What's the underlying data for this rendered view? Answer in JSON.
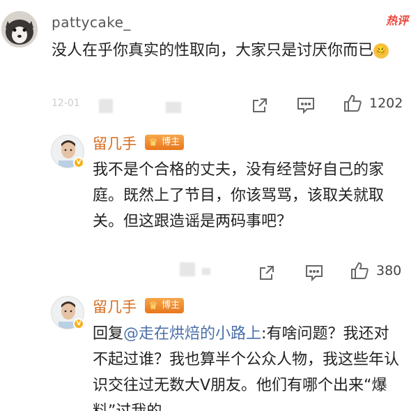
{
  "comments": [
    {
      "username": "pattycake_",
      "hot_tag": "热评",
      "text": "没人在乎你真实的性取向，大家只是讨厌你而已",
      "emoji": "🥴",
      "timestamp": "12-01",
      "likes": "1202"
    },
    {
      "username": "留几手",
      "badge": "博主",
      "text": "我不是个合格的丈夫，没有经营好自己的家庭。既然上了节目，你该骂骂，该取关就取关。但这跟造谣是两码事吧？",
      "likes": "380"
    },
    {
      "username": "留几手",
      "badge": "博主",
      "reply_prefix": "回复",
      "mention": "@走在烘焙的小路上",
      "text": ":有啥问题？我还对不起过谁？我也算半个公众人物，我这些年认识交往过无数大V朋友。他们有哪个出来“爆料”过我的"
    }
  ],
  "icons": {
    "share": "share-icon",
    "comment": "comment-icon",
    "like": "thumbs-up-icon",
    "verified": "verified-v-icon",
    "crown": "crown-icon"
  },
  "colors": {
    "username_host": "#d66a1a",
    "mention": "#4a6fa8",
    "hot_tag": "#e8463a",
    "badge": "#e8771d"
  }
}
